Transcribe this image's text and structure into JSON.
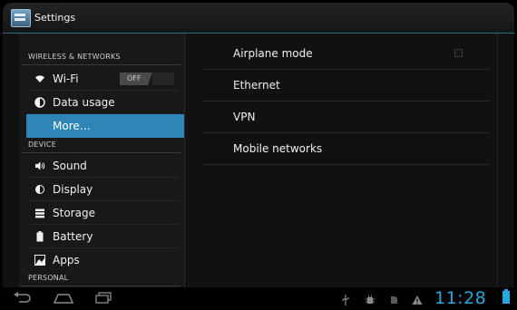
{
  "app": {
    "title": "Settings"
  },
  "sidebar": {
    "sections": [
      {
        "header": "WIRELESS & NETWORKS"
      },
      {
        "header": "DEVICE"
      },
      {
        "header": "PERSONAL"
      }
    ],
    "items": [
      {
        "label": "Wi-Fi",
        "icon": "wifi-icon",
        "toggle": "OFF"
      },
      {
        "label": "Data usage",
        "icon": "data-usage-icon"
      },
      {
        "label": "More…",
        "icon": "",
        "selected": true
      },
      {
        "label": "Sound",
        "icon": "sound-icon"
      },
      {
        "label": "Display",
        "icon": "display-icon"
      },
      {
        "label": "Storage",
        "icon": "storage-icon"
      },
      {
        "label": "Battery",
        "icon": "battery-icon"
      },
      {
        "label": "Apps",
        "icon": "apps-icon"
      }
    ]
  },
  "main": {
    "preferences": [
      {
        "label": "Airplane mode",
        "checkbox": true,
        "checked": false
      },
      {
        "label": "Ethernet"
      },
      {
        "label": "VPN"
      },
      {
        "label": "Mobile networks"
      }
    ]
  },
  "navbar": {
    "buttons": [
      "back-icon",
      "home-icon",
      "recent-apps-icon"
    ],
    "status_icons": [
      "usb-icon",
      "debug-icon",
      "sd-card-icon",
      "warning-icon"
    ],
    "clock": "11:28",
    "accent": "#2aa6df"
  },
  "colors": {
    "selected_bg": "#2f85b5",
    "accent_line": "#2f6f8c"
  }
}
